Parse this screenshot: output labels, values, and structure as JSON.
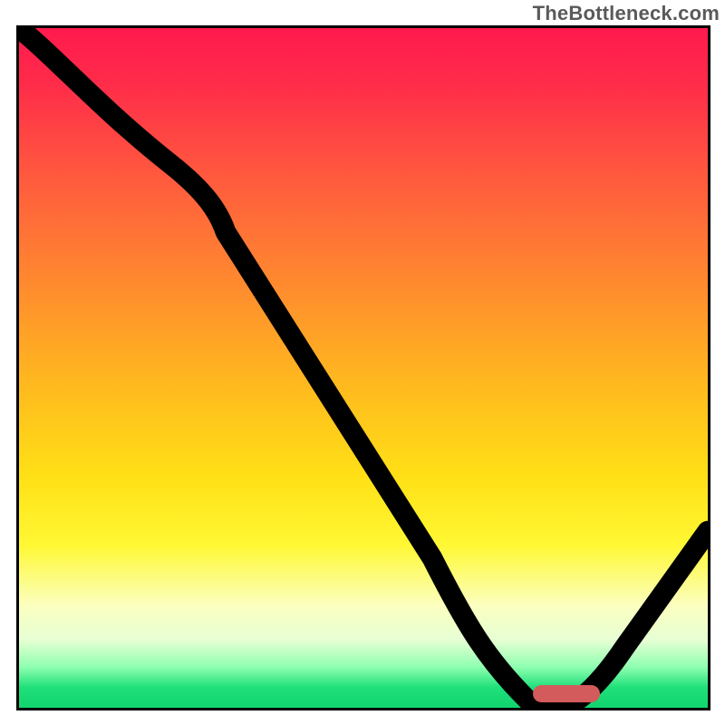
{
  "watermark": "TheBottleneck.com",
  "chart_data": {
    "type": "line",
    "title": "",
    "xlabel": "",
    "ylabel": "",
    "xlim": [
      0,
      100
    ],
    "ylim": [
      0,
      100
    ],
    "grid": false,
    "legend": false,
    "gradient_bands": [
      {
        "name": "red",
        "approx_y_range": [
          60,
          100
        ]
      },
      {
        "name": "orange",
        "approx_y_range": [
          35,
          60
        ]
      },
      {
        "name": "yellow",
        "approx_y_range": [
          10,
          35
        ]
      },
      {
        "name": "green",
        "approx_y_range": [
          0,
          10
        ]
      }
    ],
    "series": [
      {
        "name": "bottleneck-curve",
        "x": [
          0,
          10,
          22,
          30,
          40,
          50,
          60,
          68,
          74,
          80,
          88,
          100
        ],
        "y": [
          100,
          91,
          80,
          70,
          54,
          38,
          22,
          8,
          1,
          0.5,
          5,
          26
        ]
      }
    ],
    "marker": {
      "name": "optimal-range",
      "x_start": 74,
      "x_end": 83,
      "y": 1,
      "color": "#d45b5b"
    }
  }
}
